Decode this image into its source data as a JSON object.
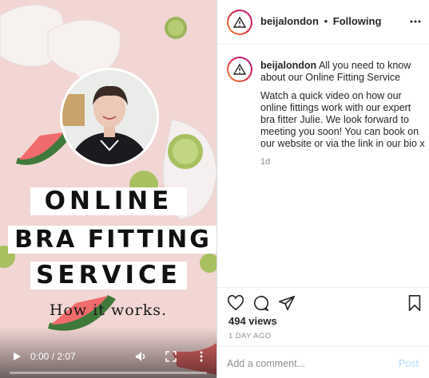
{
  "video": {
    "title_lines": [
      "ONLINE",
      "BRA FITTING",
      "SERVICE"
    ],
    "subtitle": "How it works.",
    "time": "0:00 / 2:07",
    "progress": 0.0
  },
  "header": {
    "username": "beijalondon",
    "separator": "•",
    "follow_status": "Following"
  },
  "caption": {
    "username": "beijalondon",
    "intro": "All you need to know about our Online Fitting Service",
    "body": "Watch a quick video on how our online fittings work with our expert bra fitter Julie. We look forward to meeting you soon! You can book on our website or via the link in our bio x",
    "age": "1d"
  },
  "stats": {
    "views": "494 views",
    "posted": "1 DAY AGO"
  },
  "comment": {
    "placeholder": "Add a comment...",
    "post_label": "Post"
  },
  "colors": {
    "video_bg": "#f1d6d3",
    "post_button": "#b3dbff",
    "muted_text": "#8e8e8e",
    "avatar_ring": "#dc2743"
  },
  "icons": [
    "play-icon",
    "volume-icon",
    "fullscreen-icon",
    "more-vertical-icon",
    "more-horizontal-icon",
    "warning-icon",
    "heart-icon",
    "comment-bubble-icon",
    "send-icon",
    "bookmark-icon"
  ]
}
